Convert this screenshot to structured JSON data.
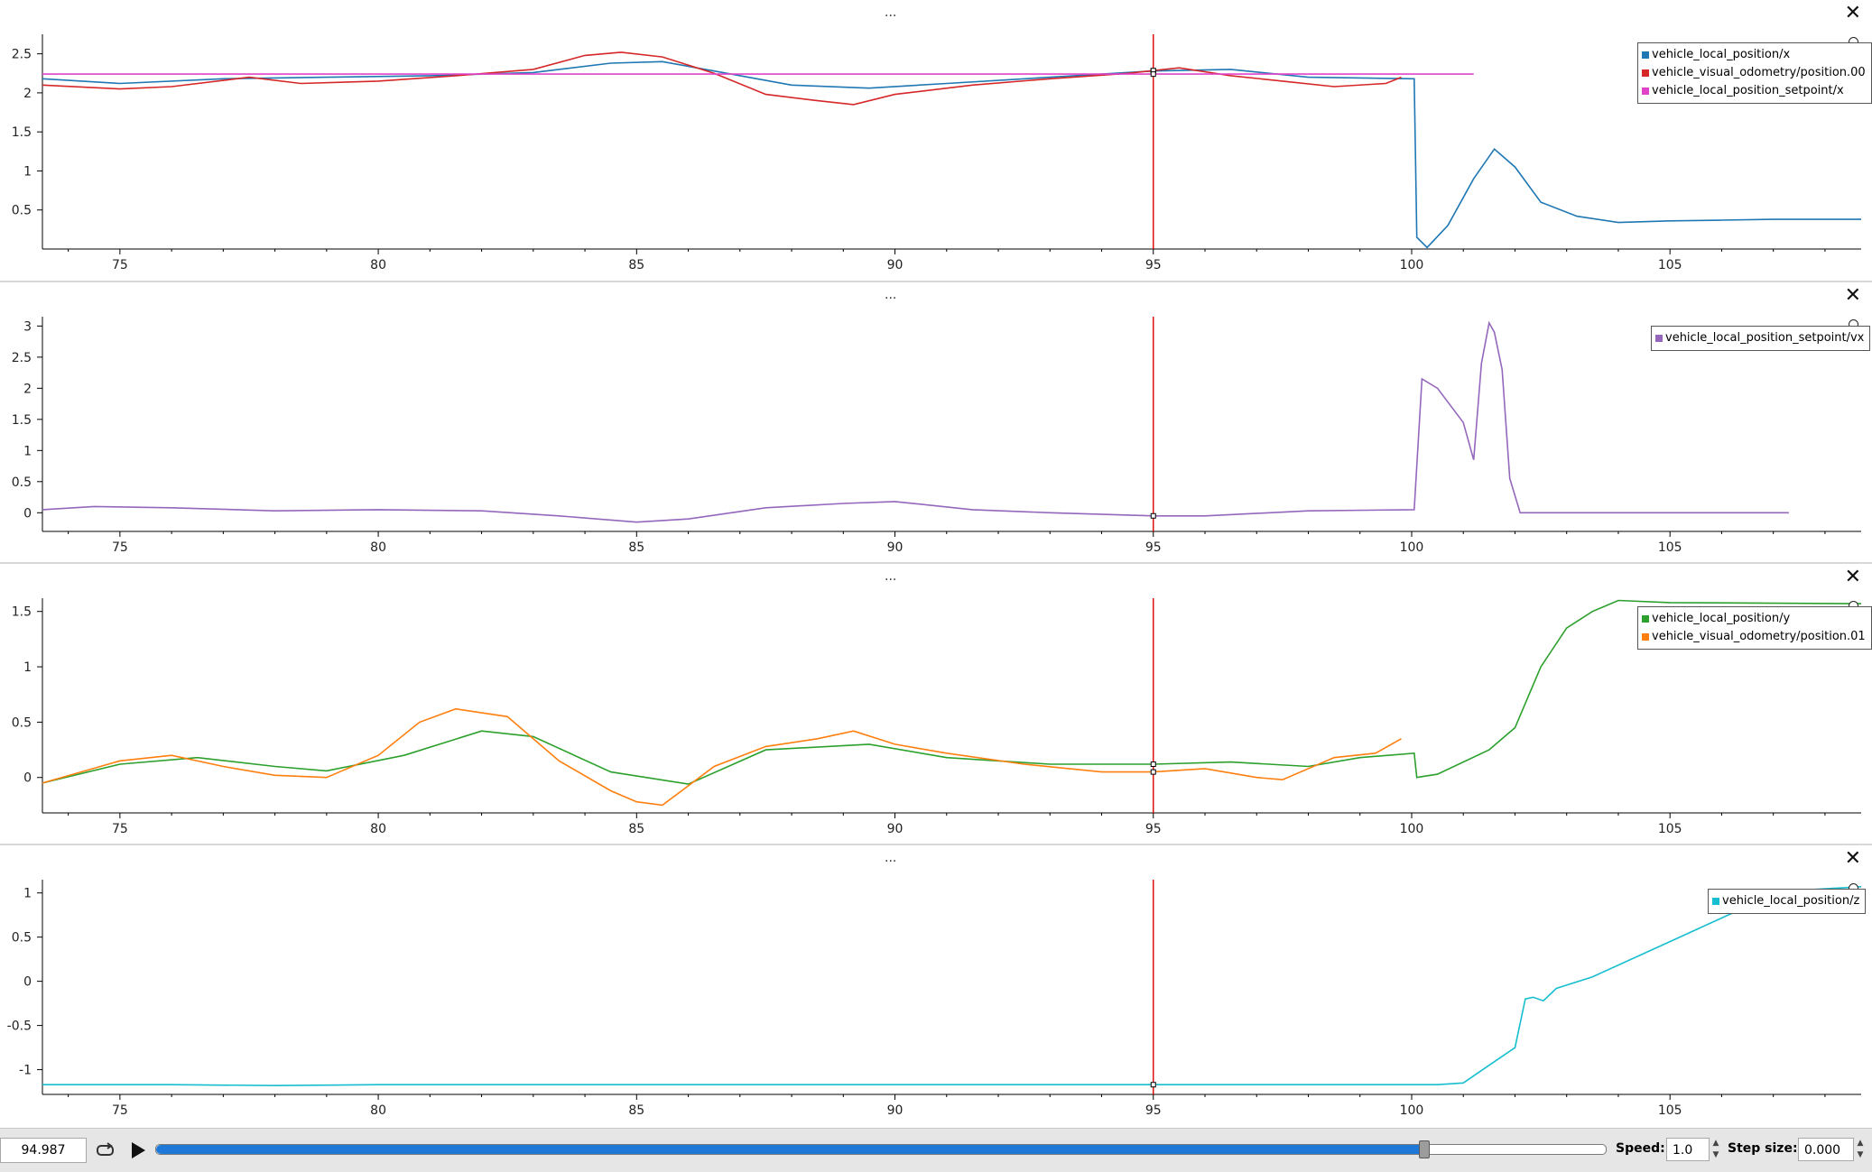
{
  "panels": [
    {
      "dots": "...",
      "yticks": [
        0.5,
        1,
        1.5,
        2,
        2.5
      ],
      "legend": [
        {
          "label": "vehicle_local_position/x",
          "color": "#1f77b4"
        },
        {
          "label": "vehicle_visual_odometry/position.00",
          "color": "#d62728"
        },
        {
          "label": "vehicle_local_position_setpoint/x",
          "color": "#e043c9"
        }
      ]
    },
    {
      "dots": "...",
      "yticks": [
        0,
        0.5,
        1,
        1.5,
        2,
        2.5,
        3
      ],
      "legend": [
        {
          "label": "vehicle_local_position_setpoint/vx",
          "color": "#9467bd"
        }
      ]
    },
    {
      "dots": "...",
      "yticks": [
        0,
        0.5,
        1,
        1.5
      ],
      "legend": [
        {
          "label": "vehicle_local_position/y",
          "color": "#2ca02c"
        },
        {
          "label": "vehicle_visual_odometry/position.01",
          "color": "#ff7f0e"
        }
      ]
    },
    {
      "dots": "...",
      "yticks": [
        -1,
        -0.5,
        0,
        0.5,
        1
      ],
      "legend": [
        {
          "label": "vehicle_local_position/z",
          "color": "#17becf"
        }
      ]
    }
  ],
  "xticks": [
    75,
    80,
    85,
    90,
    95,
    100,
    105
  ],
  "chart_data": [
    {
      "type": "line",
      "xlim": [
        73.5,
        108.7
      ],
      "ylim": [
        0,
        2.75
      ],
      "cursor_x": 95,
      "series": [
        {
          "name": "vehicle_local_position/x",
          "color": "#1f77b4",
          "x": [
            73.5,
            75,
            77,
            79,
            81,
            83,
            84.5,
            85.5,
            86.5,
            88,
            89.5,
            91,
            93,
            95,
            96.5,
            98,
            100.05,
            100.1,
            100.3,
            100.7,
            101.2,
            101.6,
            102,
            102.5,
            103.2,
            104,
            105,
            106,
            107,
            108.7
          ],
          "y": [
            2.18,
            2.12,
            2.18,
            2.2,
            2.22,
            2.26,
            2.38,
            2.4,
            2.28,
            2.1,
            2.06,
            2.12,
            2.2,
            2.28,
            2.3,
            2.2,
            2.18,
            0.15,
            0.02,
            0.3,
            0.9,
            1.28,
            1.05,
            0.6,
            0.42,
            0.34,
            0.36,
            0.37,
            0.38,
            0.38
          ]
        },
        {
          "name": "vehicle_visual_odometry/position.00",
          "color": "#d62728",
          "x": [
            73.5,
            75,
            76,
            77.5,
            78.5,
            80,
            81.5,
            83,
            84,
            84.7,
            85.5,
            86.5,
            87.5,
            88.5,
            89.2,
            90,
            91.5,
            93,
            94.5,
            95.5,
            96.5,
            97.5,
            98.5,
            99.5,
            99.8
          ],
          "y": [
            2.1,
            2.05,
            2.08,
            2.2,
            2.12,
            2.15,
            2.22,
            2.3,
            2.48,
            2.52,
            2.46,
            2.25,
            1.98,
            1.9,
            1.85,
            1.98,
            2.1,
            2.18,
            2.25,
            2.32,
            2.22,
            2.15,
            2.08,
            2.12,
            2.2
          ]
        },
        {
          "name": "vehicle_local_position_setpoint/x",
          "color": "#e043c9",
          "x": [
            73.5,
            101.2
          ],
          "y": [
            2.24,
            2.24
          ]
        }
      ]
    },
    {
      "type": "line",
      "xlim": [
        73.5,
        108.7
      ],
      "ylim": [
        -0.3,
        3.15
      ],
      "cursor_x": 95,
      "series": [
        {
          "name": "vehicle_local_position_setpoint/vx",
          "color": "#9467bd",
          "x": [
            73.5,
            74.5,
            76,
            78,
            80,
            82,
            83.5,
            85,
            86,
            87.5,
            89,
            90,
            91.5,
            93,
            95,
            96,
            98,
            100.05,
            100.2,
            100.5,
            101,
            101.2,
            101.35,
            101.5,
            101.6,
            101.75,
            101.9,
            102.1,
            107.3
          ],
          "y": [
            0.05,
            0.1,
            0.08,
            0.03,
            0.05,
            0.03,
            -0.05,
            -0.15,
            -0.1,
            0.08,
            0.15,
            0.18,
            0.05,
            0.0,
            -0.05,
            -0.05,
            0.03,
            0.05,
            2.15,
            2.0,
            1.45,
            0.85,
            2.4,
            3.05,
            2.9,
            2.3,
            0.55,
            0.0,
            0.0
          ]
        }
      ]
    },
    {
      "type": "line",
      "xlim": [
        73.5,
        108.7
      ],
      "ylim": [
        -0.32,
        1.62
      ],
      "cursor_x": 95,
      "series": [
        {
          "name": "vehicle_local_position/y",
          "color": "#2ca02c",
          "x": [
            73.5,
            75,
            76.5,
            78,
            79,
            80.5,
            82,
            83,
            84.5,
            86,
            87.5,
            89.5,
            91,
            93,
            95,
            96.5,
            98,
            99,
            100.05,
            100.1,
            100.5,
            101.5,
            102,
            102.5,
            103,
            103.5,
            104,
            105,
            108.7
          ],
          "y": [
            -0.05,
            0.12,
            0.18,
            0.1,
            0.06,
            0.2,
            0.42,
            0.37,
            0.05,
            -0.06,
            0.25,
            0.3,
            0.18,
            0.12,
            0.12,
            0.14,
            0.1,
            0.18,
            0.22,
            0.0,
            0.03,
            0.25,
            0.45,
            1.0,
            1.35,
            1.5,
            1.6,
            1.58,
            1.57
          ]
        },
        {
          "name": "vehicle_visual_odometry/position.01",
          "color": "#ff7f0e",
          "x": [
            73.5,
            75,
            76,
            77,
            78,
            79,
            80,
            80.8,
            81.5,
            82.5,
            83.5,
            84.5,
            85,
            85.5,
            86.5,
            87.5,
            88.5,
            89.2,
            90,
            91,
            92.5,
            94,
            95,
            96,
            97,
            97.5,
            98.5,
            99.3,
            99.8
          ],
          "y": [
            -0.05,
            0.15,
            0.2,
            0.1,
            0.02,
            0.0,
            0.2,
            0.5,
            0.62,
            0.55,
            0.15,
            -0.12,
            -0.22,
            -0.25,
            0.1,
            0.28,
            0.35,
            0.42,
            0.3,
            0.22,
            0.12,
            0.05,
            0.05,
            0.08,
            0.0,
            -0.02,
            0.18,
            0.22,
            0.35
          ]
        }
      ]
    },
    {
      "type": "line",
      "xlim": [
        73.5,
        108.7
      ],
      "ylim": [
        -1.28,
        1.15
      ],
      "cursor_x": 95,
      "series": [
        {
          "name": "vehicle_local_position/z",
          "color": "#17becf",
          "x": [
            73.5,
            76,
            78,
            80,
            85,
            90,
            95,
            100.5,
            101,
            101.5,
            102,
            102.2,
            102.35,
            102.55,
            102.8,
            103.5,
            105,
            106.5,
            107.5,
            108.7
          ],
          "y": [
            -1.17,
            -1.17,
            -1.18,
            -1.17,
            -1.17,
            -1.17,
            -1.17,
            -1.17,
            -1.15,
            -0.95,
            -0.75,
            -0.2,
            -0.18,
            -0.22,
            -0.08,
            0.05,
            0.45,
            0.85,
            1.03,
            1.07
          ]
        }
      ]
    }
  ],
  "playback": {
    "time": "94.987",
    "progress": 0.875,
    "speed_label": "Speed:",
    "speed_value": "1.0",
    "step_label": "Step size:",
    "step_value": "0.000"
  }
}
